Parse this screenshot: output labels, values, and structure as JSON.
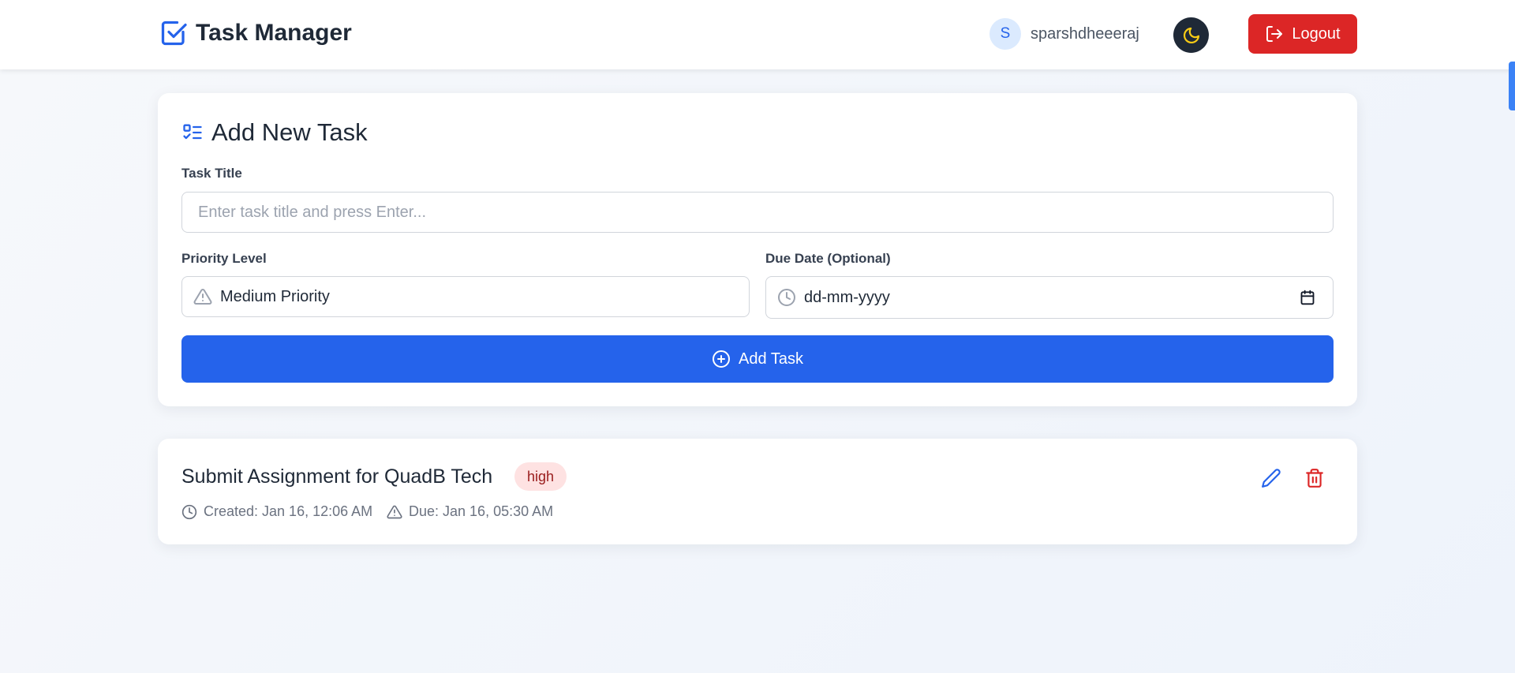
{
  "header": {
    "app_title": "Task Manager",
    "user_initial": "S",
    "username": "sparshdheeeraj",
    "logout_label": "Logout"
  },
  "form": {
    "heading": "Add New Task",
    "task_title_label": "Task Title",
    "task_title_placeholder": "Enter task title and press Enter...",
    "priority_label": "Priority Level",
    "priority_value": "Medium Priority",
    "due_date_label": "Due Date (Optional)",
    "due_date_placeholder": "dd-mm-yyyy",
    "add_button_label": "Add Task"
  },
  "tasks": [
    {
      "title": "Submit Assignment for QuadB Tech",
      "priority": "high",
      "created": "Created: Jan 16, 12:06 AM",
      "due": "Due: Jan 16, 05:30 AM"
    }
  ],
  "colors": {
    "primary": "#2563eb",
    "danger": "#dc2626",
    "badge_high_bg": "#fee2e2",
    "badge_high_text": "#991b1b"
  },
  "icons": {
    "brand": "checkbox-icon",
    "theme_toggle": "moon-icon",
    "logout": "logout-icon",
    "form_heading": "list-check-icon",
    "priority": "warning-triangle-icon",
    "due_date": "clock-icon",
    "calendar": "calendar-icon",
    "add": "plus-circle-icon",
    "edit": "pencil-icon",
    "delete": "trash-icon"
  }
}
